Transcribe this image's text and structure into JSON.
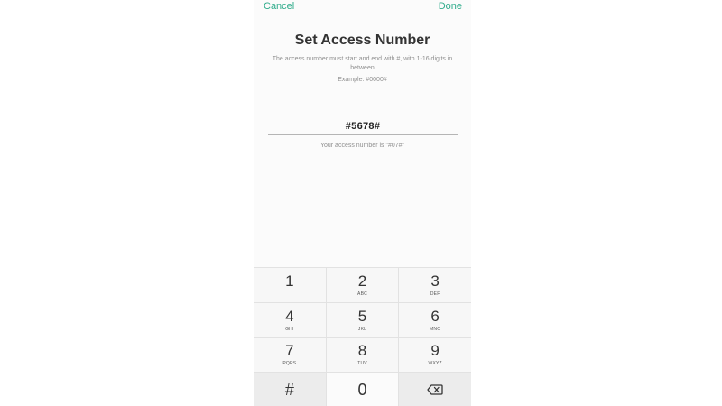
{
  "header": {
    "cancel_label": "Cancel",
    "done_label": "Done"
  },
  "title": "Set Access Number",
  "description": "The access number must start and end with #, with 1-16 digits in between",
  "example": "Example: #0000#",
  "input": {
    "value": "#5678#"
  },
  "hint": "Your access number is \"#07#\"",
  "keypad": {
    "keys": [
      {
        "digit": "1",
        "letters": ""
      },
      {
        "digit": "2",
        "letters": "ABC"
      },
      {
        "digit": "3",
        "letters": "DEF"
      },
      {
        "digit": "4",
        "letters": "GHI"
      },
      {
        "digit": "5",
        "letters": "JKL"
      },
      {
        "digit": "6",
        "letters": "MNO"
      },
      {
        "digit": "7",
        "letters": "PQRS"
      },
      {
        "digit": "8",
        "letters": "TUV"
      },
      {
        "digit": "9",
        "letters": "WXYZ"
      }
    ],
    "hash": "#",
    "zero": "0",
    "backspace_icon": "backspace-icon"
  },
  "colors": {
    "accent": "#2eab8a",
    "text": "#333333",
    "muted": "#8f8f8f",
    "keypad_bg": "#f7f7f7"
  }
}
